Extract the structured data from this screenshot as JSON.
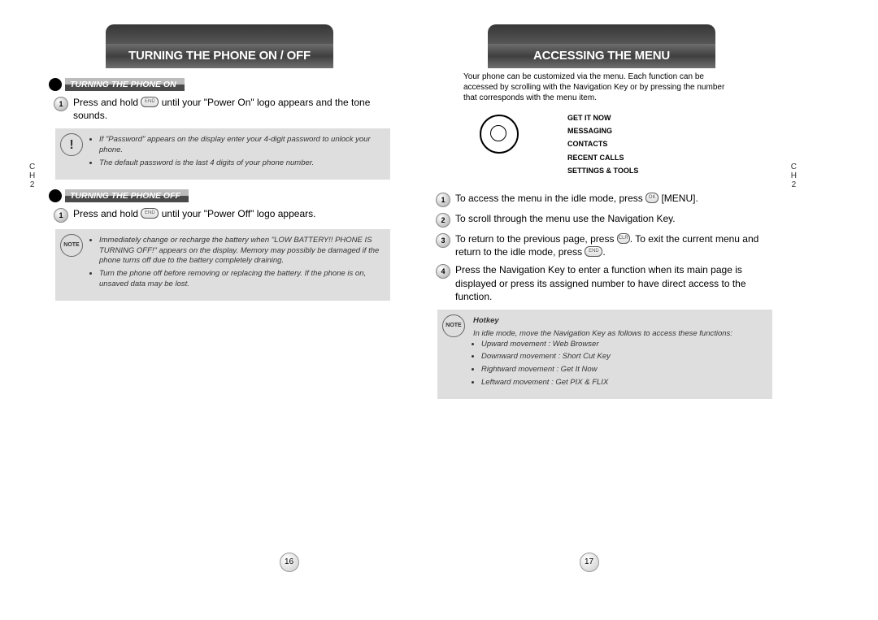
{
  "left": {
    "banner": "TURNING THE PHONE ON / OFF",
    "sections": {
      "on": {
        "title": "TURNING THE PHONE ON",
        "step1_num": "1",
        "step1_a": "Press and hold ",
        "step1_b": " until your \"Power On\" logo appears and the tone sounds.",
        "note1": "If \"Password\" appears on the display enter your 4-digit password to unlock your phone.",
        "note2": "The default password is the last 4 digits of your phone number."
      },
      "off": {
        "title": "TURNING THE PHONE OFF",
        "step1_num": "1",
        "step1_a": "Press and hold ",
        "step1_b": " until your \"Power Off\" logo appears.",
        "note1": "Immediately change or recharge the battery when \"LOW BATTERY!! PHONE IS TURNING OFF!\" appears on the display. Memory may possibly be damaged if the phone turns off due to the battery completely draining.",
        "note2": "Turn the phone off before removing or replacing the battery. If the phone is on, unsaved data may be lost."
      }
    },
    "side": {
      "c": "C",
      "h": "H",
      "n": "2"
    },
    "page_num": "16"
  },
  "right": {
    "banner": "ACCESSING THE MENU",
    "intro": "Your phone can be customized via the menu. Each function can be accessed by scrolling with the Navigation Key or by pressing the number that corresponds with the menu item.",
    "menu": {
      "i1": "GET IT NOW",
      "i2": "MESSAGING",
      "i3": "CONTACTS",
      "i4": "RECENT CALLS",
      "i5": "SETTINGS & TOOLS"
    },
    "steps": {
      "s1_num": "1",
      "s1_a": "To access the menu in the idle mode, press ",
      "s1_b": " [MENU].",
      "s2_num": "2",
      "s2": "To scroll through the menu use the Navigation Key.",
      "s3_num": "3",
      "s3_a": "To return to the previous page, press ",
      "s3_b": ". To exit the current menu and return to the idle mode, press ",
      "s3_c": ".",
      "s4_num": "4",
      "s4": "Press the Navigation Key to enter a function when its main page is displayed or press its assigned number to have direct access to the function."
    },
    "hotkey": {
      "title": "Hotkey",
      "intro": "In idle mode, move the Navigation Key as follows to access these functions:",
      "h1": "Upward movement : Web Browser",
      "h2": "Downward movement : Short Cut Key",
      "h3": "Rightward movement : Get It Now",
      "h4": "Leftward movement : Get PIX & FLIX"
    },
    "side": {
      "c": "C",
      "h": "H",
      "n": "2"
    },
    "page_num": "17"
  },
  "key_ok": "OK",
  "key_end": "END",
  "key_clr": "CLR"
}
